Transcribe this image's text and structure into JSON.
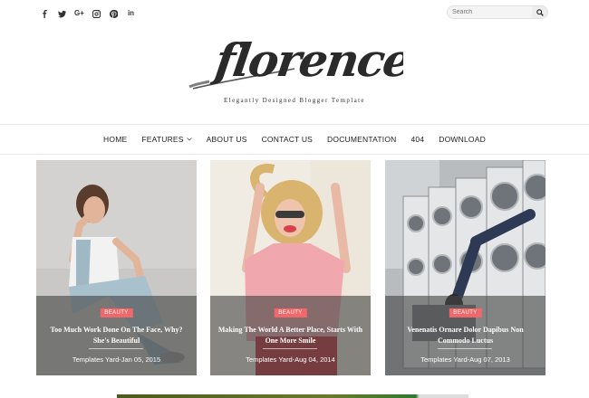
{
  "social": {
    "icons": [
      "facebook-icon",
      "twitter-icon",
      "google-plus-icon",
      "instagram-icon",
      "pinterest-icon",
      "linkedin-icon"
    ],
    "google_plus_label": "G+",
    "linkedin_label": "in"
  },
  "search": {
    "placeholder": "Search"
  },
  "logo": {
    "text": "florence"
  },
  "tagline": "Elegantly Designed Blogger Template",
  "nav": {
    "items": [
      "HOME",
      "FEATURES",
      "ABOUT US",
      "CONTACT US",
      "DOCUMENTATION",
      "404",
      "DOWNLOAD"
    ]
  },
  "posts": [
    {
      "badge": "BEAUTY",
      "title": "Too Much Work Done On The Face, Why? She's Beautiful",
      "meta": "Templates Yard-Jan 05, 2015"
    },
    {
      "badge": "BEAUTY",
      "title": "Making The World A Better Place, Starts With One More Smile",
      "meta": "Templates Yard-Aug 04, 2014"
    },
    {
      "badge": "BEAUTY",
      "title": "Venenatis Ornare Dolor Dapibus Non Commodo Luctus",
      "meta": "Templates Yard-Aug 07, 2013"
    }
  ],
  "colors": {
    "accent": "#f2686a",
    "overlay": "rgba(70,70,70,0.62)"
  }
}
